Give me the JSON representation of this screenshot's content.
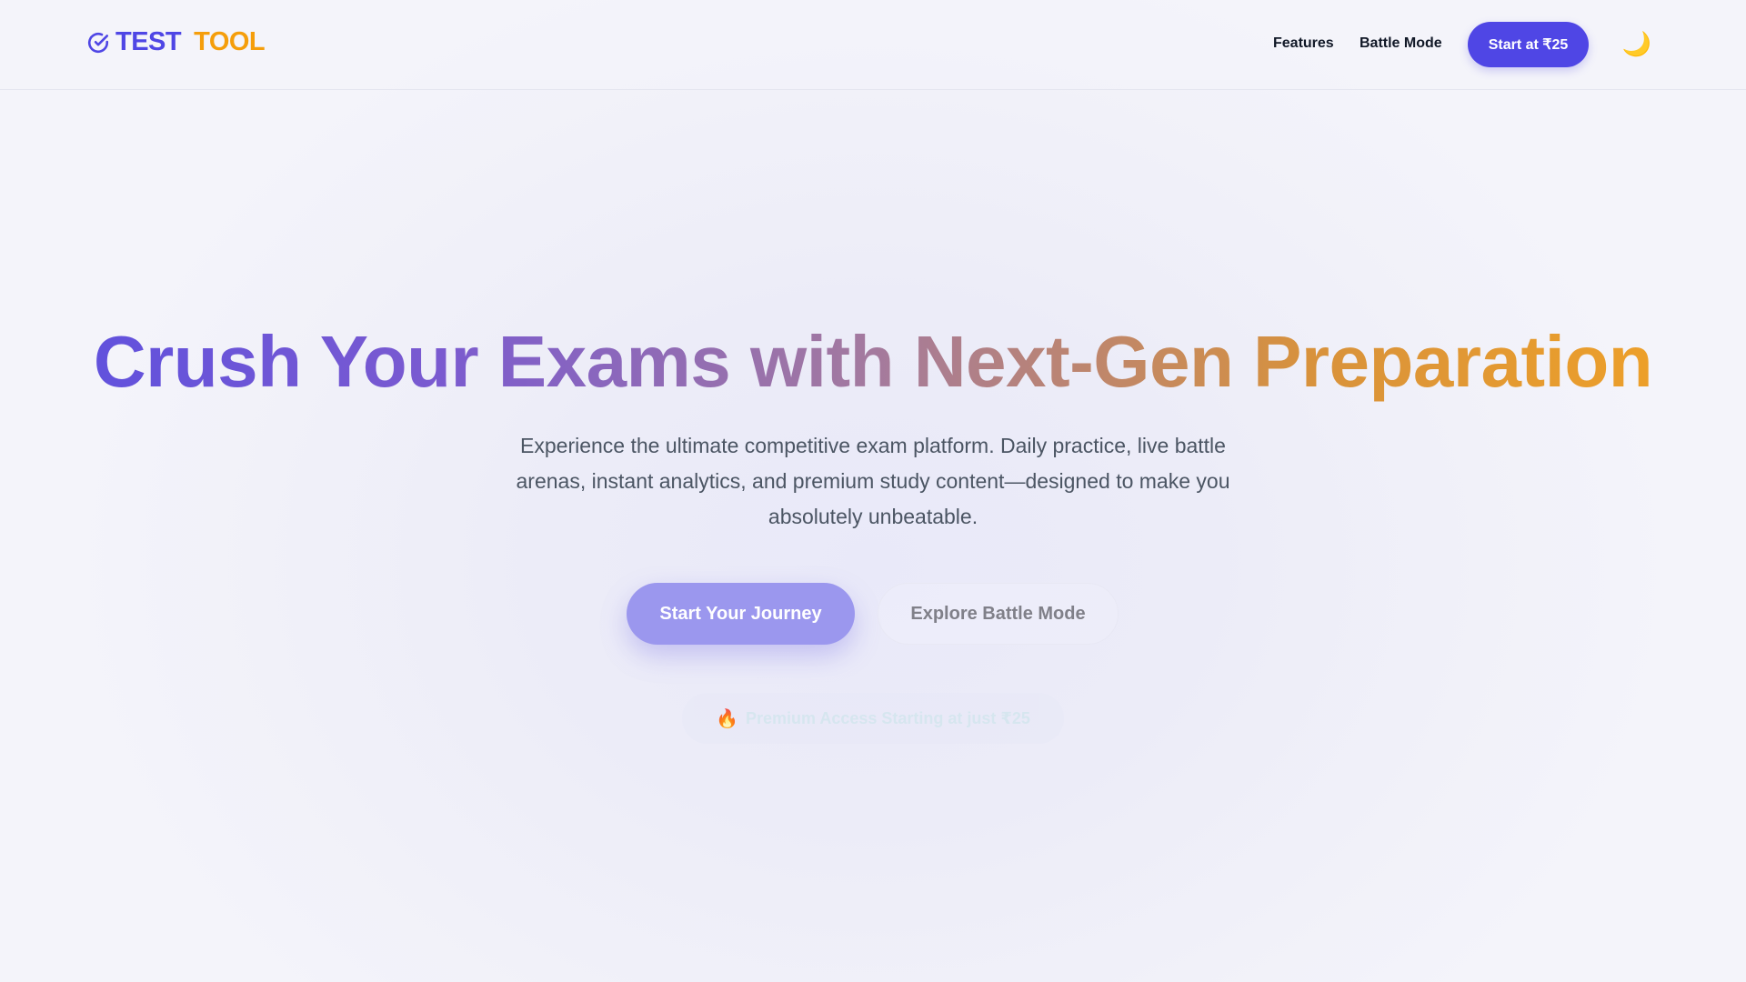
{
  "header": {
    "logo": {
      "icon": "check-circle-icon",
      "word1": "TEST",
      "word2": "TOOL",
      "color1": "#4f46e5",
      "color2": "#f59e0b"
    },
    "nav": {
      "features_label": "Features",
      "battle_label": "Battle Mode",
      "cta_label": "Start at ₹25",
      "theme_toggle_icon": "moon-icon",
      "theme_toggle_glyph": "🌙"
    }
  },
  "hero": {
    "title": "Crush Your Exams with Next-Gen Preparation",
    "subtitle": "Experience the ultimate competitive exam platform. Daily practice, live battle arenas, instant analytics, and premium study content—designed to make you absolutely unbeatable.",
    "primary_button": "Start Your Journey",
    "secondary_button": "Explore Battle Mode",
    "promo": {
      "icon": "fire-icon",
      "glyph": "🔥",
      "text": "Premium Access Starting at just ₹25"
    }
  },
  "colors": {
    "accent": "#4f46e5",
    "brand_secondary": "#f59e0b",
    "gradient_start": "#5b4fe0",
    "gradient_end": "#f2a325"
  }
}
